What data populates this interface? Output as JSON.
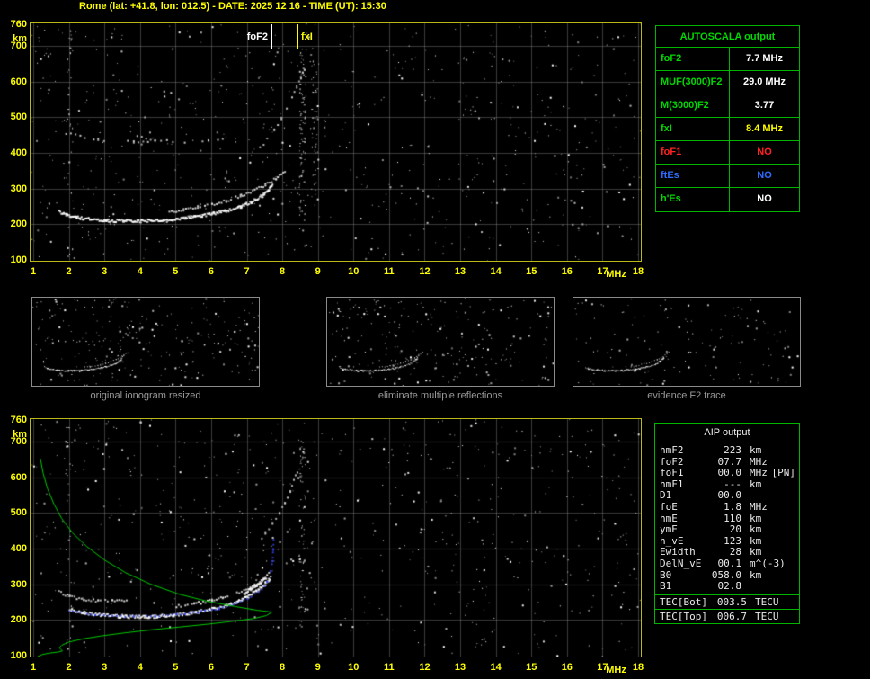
{
  "header": {
    "title": "Rome (lat: +41.8, lon: 012.5) - DATE: 2025 12 16 - TIME (UT): 15:30",
    "title_color": "#ffff00"
  },
  "colors": {
    "axis_labels": "#ffff00",
    "plot_border": "#b8b818",
    "table_border": "#00b400",
    "table_label_green": "#00d800",
    "status_no_red": "#ff2222",
    "status_no_blue": "#2f6bff",
    "fxi_yellow": "#ffff00",
    "profile_green": "#00cc00",
    "restored_trace_blue": "#3344ee"
  },
  "autoscala": {
    "title": "AUTOSCALA output",
    "rows": [
      {
        "label": "foF2",
        "value": "7.7 MHz",
        "label_color": "#00d800",
        "value_color": "#ffffff"
      },
      {
        "label": "MUF(3000)F2",
        "value": "29.0 MHz",
        "label_color": "#00d800",
        "value_color": "#ffffff"
      },
      {
        "label": "M(3000)F2",
        "value": "3.77",
        "label_color": "#00d800",
        "value_color": "#ffffff"
      },
      {
        "label": "fxI",
        "value": "8.4 MHz",
        "label_color": "#00d800",
        "value_color": "#ffff00"
      },
      {
        "label": "foF1",
        "value": "NO",
        "label_color": "#ff2222",
        "value_color": "#ff2222"
      },
      {
        "label": "ftEs",
        "value": "NO",
        "label_color": "#2f6bff",
        "value_color": "#2f6bff"
      },
      {
        "label": "h'Es",
        "value": "NO",
        "label_color": "#00d800",
        "value_color": "#ffffff"
      }
    ]
  },
  "aip": {
    "title": "AIP output",
    "rows": [
      {
        "name": "hmF2",
        "value": "223",
        "unit": "km"
      },
      {
        "name": "foF2",
        "value": "07.7",
        "unit": "MHz"
      },
      {
        "name": "foF1",
        "value": "00.0",
        "unit": "MHz",
        "note": "[PN]"
      },
      {
        "name": "hmF1",
        "value": "---",
        "unit": "km"
      },
      {
        "name": "D1",
        "value": "00.0",
        "unit": ""
      },
      {
        "name": "foE",
        "value": "1.8",
        "unit": "MHz"
      },
      {
        "name": "hmE",
        "value": "110",
        "unit": "km"
      },
      {
        "name": "ymE",
        "value": "20",
        "unit": "km"
      },
      {
        "name": "h_vE",
        "value": "123",
        "unit": "km"
      },
      {
        "name": "Ewidth",
        "value": "28",
        "unit": "km"
      },
      {
        "name": "DelN_vE",
        "value": "00.1",
        "unit": "m^(-3)"
      },
      {
        "name": "B0",
        "value": "058.0",
        "unit": "km"
      },
      {
        "name": "B1",
        "value": "02.8",
        "unit": ""
      }
    ],
    "tec_rows": [
      {
        "name": "TEC[Bot]",
        "value": "003.5",
        "unit": "TECU"
      },
      {
        "name": "TEC[Top]",
        "value": "006.7",
        "unit": "TECU"
      }
    ]
  },
  "thumbnails": [
    {
      "caption": "original ionogram resized",
      "series": [
        "f2-trace-o",
        "f2-trace-x",
        "multiple-reflection-arc-1",
        "multiple-reflection-arc-2",
        "second-hop-trace"
      ],
      "noise_seed": 31,
      "noise_count": 260
    },
    {
      "caption": "eliminate multiple reflections",
      "series": [
        "f2-trace-o",
        "f2-trace-x"
      ],
      "noise_seed": 47,
      "noise_count": 230
    },
    {
      "caption": "evidence F2 trace",
      "series": [
        "f2-trace-o",
        "f2-trace-x"
      ],
      "noise_seed": 63,
      "noise_count": 140
    }
  ],
  "chart_data": [
    {
      "id": "ionogram",
      "type": "scatter",
      "title": "scaled ionogram",
      "xlabel": "MHz",
      "ylabel": "km",
      "xlim": [
        1,
        18
      ],
      "ylim": [
        100,
        760
      ],
      "xticks": [
        1,
        2,
        3,
        4,
        5,
        6,
        7,
        8,
        9,
        10,
        11,
        12,
        13,
        14,
        15,
        16,
        17,
        18
      ],
      "yticks": [
        760,
        700,
        600,
        500,
        400,
        300,
        200,
        100
      ],
      "grid": true,
      "legend": "none",
      "markers": [
        {
          "label": "foF2",
          "x": 7.7,
          "color": "#ffffff"
        },
        {
          "label": "fxI",
          "x": 8.4,
          "color": "#ffff00"
        }
      ],
      "series": [
        {
          "name": "f2-trace-o",
          "color": "#ffffff",
          "style": "thick",
          "points": [
            [
              1.7,
              238
            ],
            [
              1.9,
              228
            ],
            [
              2.2,
              221
            ],
            [
              2.6,
              216
            ],
            [
              3.0,
              213
            ],
            [
              3.5,
              211
            ],
            [
              4.0,
              211
            ],
            [
              4.5,
              213
            ],
            [
              5.0,
              217
            ],
            [
              5.5,
              223
            ],
            [
              6.0,
              231
            ],
            [
              6.4,
              240
            ],
            [
              6.8,
              252
            ],
            [
              7.1,
              264
            ],
            [
              7.4,
              282
            ],
            [
              7.6,
              300
            ],
            [
              7.7,
              316
            ]
          ]
        },
        {
          "name": "f2-trace-x",
          "color": "#e8e8e8",
          "style": "med",
          "points": [
            [
              4.8,
              238
            ],
            [
              5.2,
              243
            ],
            [
              5.6,
              250
            ],
            [
              6.0,
              258
            ],
            [
              6.4,
              268
            ],
            [
              6.8,
              281
            ],
            [
              7.2,
              297
            ],
            [
              7.5,
              313
            ],
            [
              7.8,
              331
            ],
            [
              8.1,
              352
            ]
          ]
        },
        {
          "name": "multiple-reflection-arc-1",
          "color": "#d0d0d0",
          "style": "dots",
          "points": [
            [
              1.9,
              458
            ],
            [
              2.3,
              448
            ],
            [
              2.8,
              440
            ],
            [
              3.3,
              435
            ],
            [
              3.8,
              433
            ],
            [
              4.2,
              435
            ]
          ]
        },
        {
          "name": "multiple-reflection-arc-2",
          "color": "#d0d0d0",
          "style": "dots",
          "points": [
            [
              3.9,
              447
            ],
            [
              4.4,
              439
            ],
            [
              4.9,
              434
            ],
            [
              5.4,
              433
            ],
            [
              5.9,
              437
            ],
            [
              6.3,
              444
            ]
          ]
        },
        {
          "name": "second-hop-trace",
          "color": "#cccccc",
          "style": "dots",
          "points": [
            [
              7.35,
              415
            ],
            [
              7.55,
              440
            ],
            [
              7.75,
              468
            ],
            [
              7.95,
              498
            ],
            [
              8.1,
              528
            ],
            [
              8.25,
              558
            ],
            [
              8.38,
              588
            ],
            [
              8.5,
              612
            ],
            [
              8.6,
              636
            ]
          ]
        }
      ],
      "noise": {
        "seed": 20251216,
        "count": 720,
        "columns": [
          {
            "x": 8.55,
            "h_min": 180,
            "h_max": 700,
            "count": 80
          },
          {
            "x": 8.9,
            "h_min": 240,
            "h_max": 660,
            "count": 45
          },
          {
            "x": 2.02,
            "h_min": 110,
            "h_max": 750,
            "count": 30
          }
        ]
      }
    },
    {
      "id": "profile-ionogram",
      "type": "scatter",
      "title": "restored trace and electron density profile",
      "xlabel": "MHz",
      "ylabel": "km",
      "xlim": [
        1,
        18
      ],
      "ylim": [
        100,
        760
      ],
      "xticks": [
        1,
        2,
        3,
        4,
        5,
        6,
        7,
        8,
        9,
        10,
        11,
        12,
        13,
        14,
        15,
        16,
        17,
        18
      ],
      "yticks": [
        760,
        700,
        600,
        500,
        400,
        300,
        200,
        100
      ],
      "grid": true,
      "legend": "none",
      "markers": [],
      "series": [
        {
          "name": "f2-trace-o",
          "color": "#ffffff",
          "style": "thick",
          "points": [
            [
              2.0,
              232
            ],
            [
              2.4,
              222
            ],
            [
              2.9,
              216
            ],
            [
              3.4,
              212
            ],
            [
              3.9,
              211
            ],
            [
              4.4,
              212
            ],
            [
              4.9,
              216
            ],
            [
              5.4,
              222
            ],
            [
              5.9,
              230
            ],
            [
              6.3,
              240
            ],
            [
              6.7,
              253
            ],
            [
              7.0,
              267
            ],
            [
              7.3,
              286
            ],
            [
              7.5,
              304
            ],
            [
              7.65,
              320
            ]
          ]
        },
        {
          "name": "nose-blob",
          "color": "#ffffff",
          "style": "thick",
          "points": [
            [
              6.9,
              276
            ],
            [
              7.15,
              292
            ],
            [
              7.35,
              306
            ],
            [
              7.5,
              318
            ]
          ]
        },
        {
          "name": "f2-trace-x",
          "color": "#f0f0f0",
          "style": "med",
          "points": [
            [
              5.0,
              241
            ],
            [
              5.5,
              248
            ],
            [
              6.0,
              257
            ],
            [
              6.5,
              270
            ],
            [
              6.9,
              284
            ],
            [
              7.2,
              299
            ],
            [
              7.45,
              316
            ],
            [
              7.6,
              332
            ]
          ]
        },
        {
          "name": "left-arc",
          "color": "#e0e0e0",
          "style": "med",
          "points": [
            [
              1.7,
              281
            ],
            [
              2.0,
              268
            ],
            [
              2.4,
              260
            ],
            [
              2.8,
              256
            ],
            [
              3.2,
              255
            ],
            [
              3.6,
              259
            ]
          ]
        },
        {
          "name": "second-hop-trace",
          "color": "#cccccc",
          "style": "dots",
          "points": [
            [
              7.3,
              420
            ],
            [
              7.5,
              446
            ],
            [
              7.7,
              472
            ],
            [
              7.9,
              502
            ],
            [
              8.05,
              532
            ],
            [
              8.2,
              562
            ],
            [
              8.3,
              592
            ],
            [
              8.4,
              618
            ]
          ]
        },
        {
          "name": "restored-trace",
          "color": "#3344ee",
          "style": "dots2",
          "points": [
            [
              2.0,
              229
            ],
            [
              2.6,
              219
            ],
            [
              3.2,
              214
            ],
            [
              3.8,
              212
            ],
            [
              4.4,
              213
            ],
            [
              5.0,
              217
            ],
            [
              5.6,
              224
            ],
            [
              6.2,
              234
            ],
            [
              6.7,
              248
            ],
            [
              7.1,
              266
            ],
            [
              7.4,
              288
            ],
            [
              7.55,
              310
            ],
            [
              7.65,
              338
            ],
            [
              7.7,
              368
            ],
            [
              7.72,
              400
            ],
            [
              7.73,
              425
            ]
          ]
        },
        {
          "name": "electron-density-profile",
          "color": "#00cc00",
          "style": "line",
          "points": [
            [
              1.2,
              652
            ],
            [
              1.28,
              610
            ],
            [
              1.4,
              568
            ],
            [
              1.58,
              525
            ],
            [
              1.8,
              484
            ],
            [
              2.1,
              444
            ],
            [
              2.5,
              406
            ],
            [
              3.0,
              368
            ],
            [
              3.6,
              332
            ],
            [
              4.3,
              300
            ],
            [
              5.1,
              272
            ],
            [
              5.9,
              252
            ],
            [
              6.7,
              237
            ],
            [
              7.3,
              227
            ],
            [
              7.62,
              223
            ],
            [
              7.7,
              221
            ],
            [
              7.55,
              212
            ],
            [
              7.2,
              204
            ],
            [
              6.6,
              196
            ],
            [
              5.9,
              188
            ],
            [
              5.1,
              180
            ],
            [
              4.3,
              172
            ],
            [
              3.6,
              164
            ],
            [
              2.9,
              155
            ],
            [
              2.4,
              147
            ],
            [
              2.0,
              138
            ],
            [
              1.8,
              129
            ],
            [
              1.73,
              122
            ],
            [
              1.78,
              117
            ],
            [
              1.82,
              113
            ],
            [
              1.7,
              110
            ],
            [
              1.45,
              107
            ],
            [
              1.25,
              103
            ],
            [
              1.12,
              97
            ]
          ]
        }
      ],
      "noise": {
        "seed": 77031530,
        "count": 680,
        "columns": [
          {
            "x": 8.55,
            "h_min": 180,
            "h_max": 700,
            "count": 70
          },
          {
            "x": 2.0,
            "h_min": 110,
            "h_max": 750,
            "count": 25
          }
        ]
      }
    }
  ]
}
